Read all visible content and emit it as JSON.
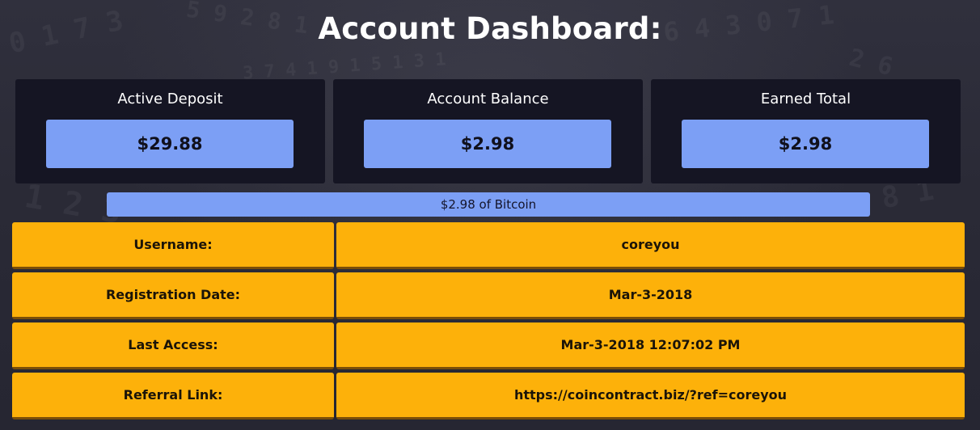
{
  "page": {
    "title": "Account Dashboard:"
  },
  "stats": [
    {
      "label": "Active Deposit",
      "value": "$29.88"
    },
    {
      "label": "Account Balance",
      "value": "$2.98"
    },
    {
      "label": "Earned Total",
      "value": "$2.98"
    }
  ],
  "balance_bar": {
    "text": "$2.98 of Bitcoin"
  },
  "account_info": [
    {
      "label": "Username:",
      "value": "coreyou"
    },
    {
      "label": "Registration Date:",
      "value": "Mar-3-2018"
    },
    {
      "label": "Last Access:",
      "value": "Mar-3-2018 12:07:02 PM"
    },
    {
      "label": "Referral Link:",
      "value": "https://coincontract.biz/?ref=coreyou"
    }
  ],
  "colors": {
    "background": "#2a2a36",
    "card_background": "#151523",
    "stat_value_background": "#7c9ff5",
    "info_row_background": "#fdb10a",
    "title_text": "#ffffff"
  }
}
